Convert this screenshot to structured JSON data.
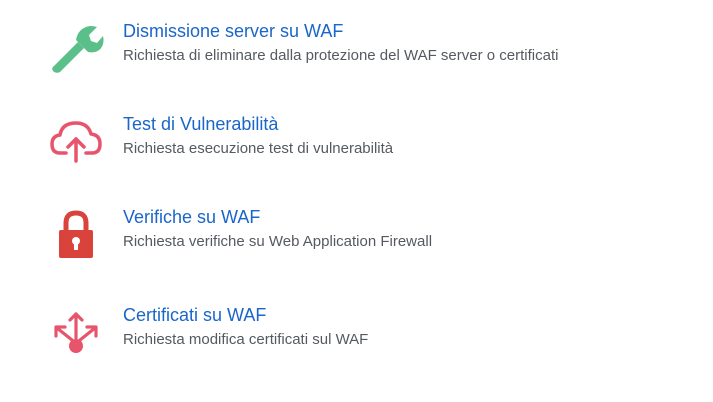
{
  "items": [
    {
      "title": "Dismissione server su WAF",
      "description": "Richiesta di eliminare dalla protezione del WAF server o certificati",
      "icon": "wrench-icon",
      "icon_color": "#5bbf8a"
    },
    {
      "title": "Test di Vulnerabilità",
      "description": "Richiesta esecuzione test di vulnerabilità",
      "icon": "cloud-upload-icon",
      "icon_color": "#e8546b"
    },
    {
      "title": "Verifiche su WAF",
      "description": "Richiesta verifiche su Web Application Firewall",
      "icon": "lock-icon",
      "icon_color": "#d9433c"
    },
    {
      "title": "Certificati su WAF",
      "description": "Richiesta modifica certificati sul WAF",
      "icon": "share-nodes-icon",
      "icon_color": "#e8546b"
    }
  ]
}
